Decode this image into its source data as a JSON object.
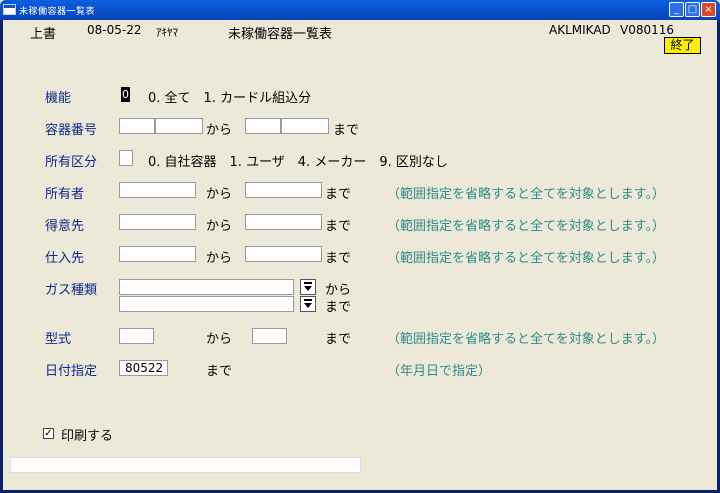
{
  "window": {
    "title": "未稼働容器一覧表",
    "minimize": "_",
    "maximize": "□",
    "close": "×"
  },
  "header": {
    "mode": "上書",
    "date": "08-05-22",
    "user": "ｱｷﾔﾏ",
    "screen_title": "未稼働容器一覧表",
    "program_id": "AKLMIKAD",
    "version": "V080116",
    "exit_label": "終了"
  },
  "form": {
    "function": {
      "label": "機能",
      "value": "0",
      "options": "0. 全て　1. カードル組込分"
    },
    "container_no": {
      "label": "容器番号",
      "from": "から",
      "to": "まで"
    },
    "ownership": {
      "label": "所有区分",
      "options": "0. 自社容器　1. ユーザ　4. メーカー　9. 区別なし"
    },
    "owner": {
      "label": "所有者",
      "from": "から",
      "to": "まで",
      "hint": "（範囲指定を省略すると全てを対象とします。）"
    },
    "customer": {
      "label": "得意先",
      "from": "から",
      "to": "まで",
      "hint": "（範囲指定を省略すると全てを対象とします。）"
    },
    "supplier": {
      "label": "仕入先",
      "from": "から",
      "to": "まで",
      "hint": "（範囲指定を省略すると全てを対象とします。）"
    },
    "gas_type": {
      "label": "ガス種類",
      "from": "から",
      "to": "まで"
    },
    "model": {
      "label": "型式",
      "from": "から",
      "to": "まで",
      "hint": "（範囲指定を省略すると全てを対象とします。）"
    },
    "date_spec": {
      "label": "日付指定",
      "value": "80522",
      "to": "まで",
      "hint": "（年月日で指定）"
    },
    "print": {
      "label": "印刷する",
      "checked": "✓"
    }
  }
}
